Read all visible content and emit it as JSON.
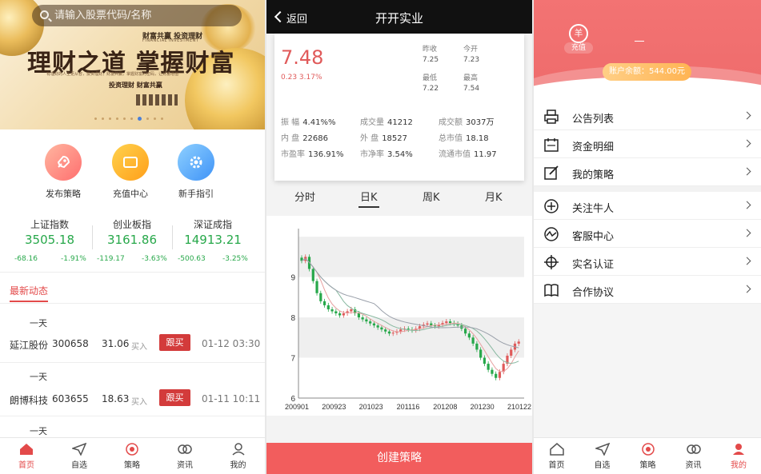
{
  "home": {
    "search_placeholder": "请输入股票代码/名称",
    "banner": {
      "title": "理财之道 掌握财富",
      "subtitle": "财富共赢 投资理财",
      "subtitle_en": "FINANCIAL INVESTMENT",
      "small_text": "有理财的人生更从容，投资理财，财富共赢，掌握财富的密码，让财富增值",
      "tagline": "投资理财 财富共赢"
    },
    "quick_links": [
      {
        "label": "发布策略",
        "icon": "rocket-icon"
      },
      {
        "label": "充值中心",
        "icon": "wallet-card-icon"
      },
      {
        "label": "新手指引",
        "icon": "gear-icon"
      }
    ],
    "indices": [
      {
        "name": "上证指数",
        "value": "3505.18",
        "change": "-68.16",
        "pct": "-1.91%"
      },
      {
        "name": "创业板指",
        "value": "3161.86",
        "change": "-119.17",
        "pct": "-3.63%"
      },
      {
        "name": "深证成指",
        "value": "14913.21",
        "change": "-500.63",
        "pct": "-3.25%"
      }
    ],
    "section_title": "最新动态",
    "trades": [
      {
        "period": "一天",
        "name": "延江股份",
        "code": "300658",
        "price": "31.06",
        "action": "买入",
        "button": "跟买",
        "time": "01-12 03:30"
      },
      {
        "period": "一天",
        "name": "朗博科技",
        "code": "603655",
        "price": "18.63",
        "action": "买入",
        "button": "跟买",
        "time": "01-11 10:11"
      },
      {
        "period": "一天"
      }
    ],
    "tabbar": [
      {
        "label": "首页",
        "icon": "home-icon",
        "active": true
      },
      {
        "label": "自选",
        "icon": "paper-plane-icon",
        "active": false
      },
      {
        "label": "策略",
        "icon": "target-icon",
        "active": false
      },
      {
        "label": "资讯",
        "icon": "link-rings-icon",
        "active": false
      },
      {
        "label": "我的",
        "icon": "user-icon",
        "active": false
      }
    ]
  },
  "stock": {
    "back_label": "返回",
    "title": "开开实业",
    "price": "7.48",
    "change_text": "0.23 3.17%",
    "quote": [
      {
        "label": "昨收",
        "value": "7.25"
      },
      {
        "label": "今开",
        "value": "7.23"
      },
      {
        "label": "最低",
        "value": "7.22"
      },
      {
        "label": "最高",
        "value": "7.54"
      }
    ],
    "stats": [
      {
        "label": "振 幅",
        "value": "4.41%%"
      },
      {
        "label": "成交量",
        "value": "41212"
      },
      {
        "label": "成交额",
        "value": "3037万"
      },
      {
        "label": "内 盘",
        "value": "22686"
      },
      {
        "label": "外 盘",
        "value": "18527"
      },
      {
        "label": "总市值",
        "value": "18.18"
      },
      {
        "label": "市盈率",
        "value": "136.91%"
      },
      {
        "label": "市净率",
        "value": "3.54%"
      },
      {
        "label": "流通市值",
        "value": "11.97"
      }
    ],
    "period_tabs": [
      {
        "label": "分时",
        "active": false
      },
      {
        "label": "日K",
        "active": true
      },
      {
        "label": "周K",
        "active": false
      },
      {
        "label": "月K",
        "active": false
      }
    ],
    "create_button": "创建策略"
  },
  "chart_data": {
    "type": "candlestick",
    "y_ticks": [
      6,
      7,
      8,
      9
    ],
    "ylim": [
      6,
      10.2
    ],
    "x_ticks": [
      "200901",
      "200923",
      "201023",
      "201116",
      "201208",
      "201230",
      "210122"
    ],
    "close_series": [
      9.4,
      9.5,
      9.2,
      8.9,
      8.6,
      8.4,
      8.3,
      8.2,
      8.15,
      8.1,
      8.05,
      8.1,
      8.15,
      8.2,
      8.1,
      8.0,
      7.95,
      7.9,
      7.85,
      7.8,
      7.75,
      7.7,
      7.65,
      7.6,
      7.62,
      7.65,
      7.7,
      7.72,
      7.7,
      7.68,
      7.72,
      7.78,
      7.82,
      7.85,
      7.8,
      7.78,
      7.82,
      7.86,
      7.9,
      7.86,
      7.84,
      7.8,
      7.72,
      7.6,
      7.5,
      7.35,
      7.2,
      7.0,
      6.85,
      6.7,
      6.6,
      6.5,
      6.65,
      6.85,
      7.05,
      7.2,
      7.35,
      7.4
    ]
  },
  "account": {
    "avatar_text": "羊",
    "recharge_label": "充值",
    "balance_text": "账户余额：544.00元",
    "menu_group1": [
      {
        "label": "公告列表",
        "icon": "printer-icon"
      },
      {
        "label": "资金明细",
        "icon": "calendar-icon"
      },
      {
        "label": "我的策略",
        "icon": "edit-icon"
      }
    ],
    "menu_group2": [
      {
        "label": "关注牛人",
        "icon": "plus-circle-icon"
      },
      {
        "label": "客服中心",
        "icon": "activity-icon"
      },
      {
        "label": "实名认证",
        "icon": "crosshair-icon"
      },
      {
        "label": "合作协议",
        "icon": "book-icon"
      }
    ],
    "tabbar": [
      {
        "label": "首页",
        "icon": "home-icon",
        "active": false
      },
      {
        "label": "自选",
        "icon": "paper-plane-icon",
        "active": false
      },
      {
        "label": "策略",
        "icon": "target-icon",
        "active": false
      },
      {
        "label": "资讯",
        "icon": "link-rings-icon",
        "active": false
      },
      {
        "label": "我的",
        "icon": "user-icon",
        "active": true
      }
    ]
  },
  "colors": {
    "accent": "#e34a4a",
    "up": "#e05a5a",
    "down": "#27a84a",
    "gold": "#ffb453"
  }
}
